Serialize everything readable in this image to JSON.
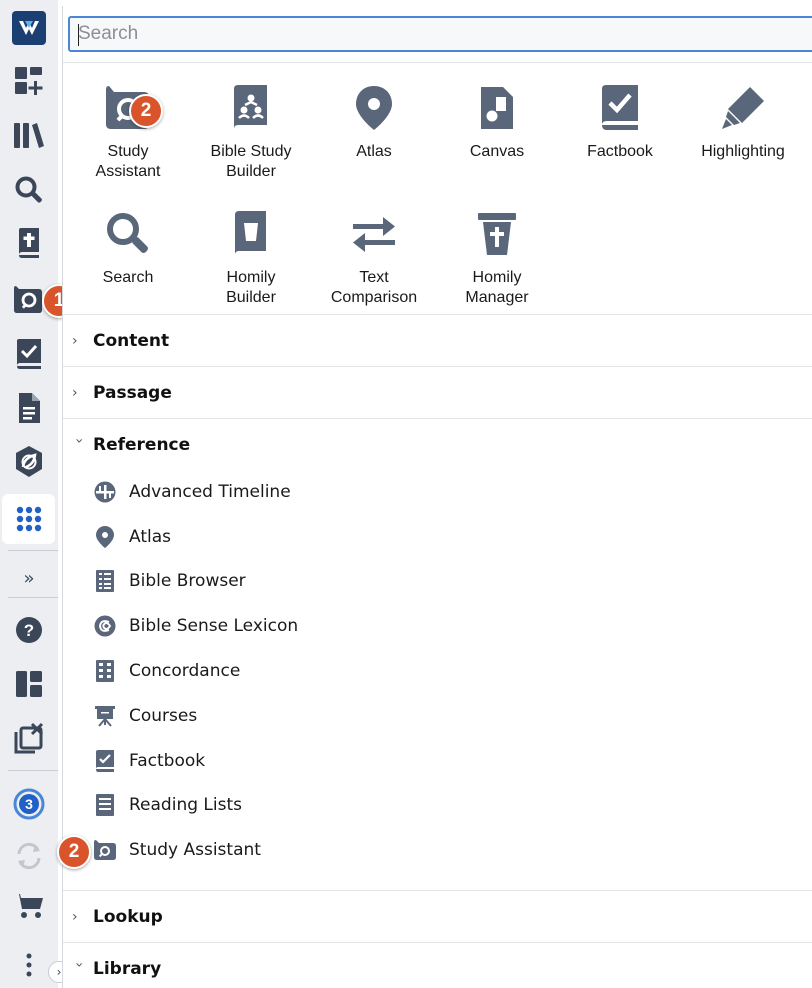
{
  "search": {
    "placeholder": "Search"
  },
  "tools": [
    {
      "label": "Study\nAssistant",
      "icon": "study-assistant-icon"
    },
    {
      "label": "Bible Study\nBuilder",
      "icon": "bible-study-builder-icon"
    },
    {
      "label": "Atlas",
      "icon": "map-pin-icon"
    },
    {
      "label": "Canvas",
      "icon": "canvas-icon"
    },
    {
      "label": "Factbook",
      "icon": "factbook-icon"
    },
    {
      "label": "Highlighting",
      "icon": "highlighter-icon"
    },
    {
      "label": "Search",
      "icon": "search-icon"
    },
    {
      "label": "Homily\nBuilder",
      "icon": "homily-builder-icon"
    },
    {
      "label": "Text\nComparison",
      "icon": "compare-arrows-icon"
    },
    {
      "label": "Homily\nManager",
      "icon": "homily-manager-icon"
    }
  ],
  "sections": {
    "content": "Content",
    "passage": "Passage",
    "reference": "Reference",
    "lookup": "Lookup",
    "library": "Library"
  },
  "reference_items": [
    {
      "label": "Advanced Timeline",
      "icon": "timeline-icon"
    },
    {
      "label": "Atlas",
      "icon": "map-pin-icon"
    },
    {
      "label": "Bible Browser",
      "icon": "bible-browser-icon"
    },
    {
      "label": "Bible Sense Lexicon",
      "icon": "lexicon-icon"
    },
    {
      "label": "Concordance",
      "icon": "concordance-icon"
    },
    {
      "label": "Courses",
      "icon": "courses-icon"
    },
    {
      "label": "Factbook",
      "icon": "factbook-icon"
    },
    {
      "label": "Reading Lists",
      "icon": "reading-list-icon"
    },
    {
      "label": "Study Assistant",
      "icon": "study-assistant-icon"
    }
  ],
  "badges": {
    "rail": "1",
    "tile": "2",
    "list": "2"
  },
  "rail": {
    "notification_count": "3"
  },
  "colors": {
    "icon": "#5a6679",
    "badge": "#d9542b",
    "accent": "#4a86d6",
    "logo": "#1c3f73"
  }
}
